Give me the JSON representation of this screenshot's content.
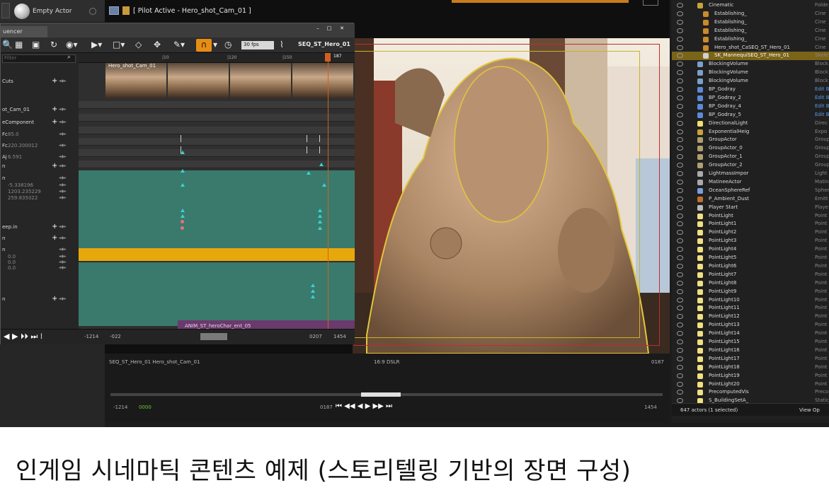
{
  "left_panel": {
    "actor_label": "Empty Actor"
  },
  "viewport": {
    "title": "[ Pilot Active - Hero_shot_Cam_01 ]",
    "info_left": "SEQ_ST_Hero_01  Hero_shot_Cam_01",
    "info_center": "16:9 DSLR",
    "info_right": "0187",
    "ctrl_start": "-1214",
    "ctrl_start2": "0000",
    "ctrl_mid": "0187",
    "ctrl_end_red": "",
    "ctrl_end": "1454"
  },
  "sequencer": {
    "tab_label": "uencer",
    "fps": "30 fps",
    "sequence_name": "SEQ_ST_Hero_01",
    "search_placeholder": "Filter",
    "ruler_end": "187",
    "ruler_labels": [
      "|10",
      "|120",
      "|150",
      "|1"
    ],
    "shot_label": "Hero_shot_Cam_01",
    "anim_clip": "ANIM_ST_heroChar_ent_05",
    "tracks": [
      {
        "label": "Cuts"
      },
      {
        "label": "ot_Cam_01"
      },
      {
        "label": "eComponent"
      },
      {
        "label": "Fc",
        "value": "85.0"
      },
      {
        "label": "Fc",
        "value": "220.200012"
      },
      {
        "label": "Aj",
        "value": "6.591"
      },
      {
        "label": "n"
      },
      {
        "label": "n"
      },
      {
        "label": "",
        "value": "-5.338196"
      },
      {
        "label": "",
        "value": "1203.235229"
      },
      {
        "label": "",
        "value": "259.835022"
      },
      {
        "label": "eep.in"
      },
      {
        "label": "n"
      },
      {
        "label": "n"
      },
      {
        "label": "",
        "value": "0.0"
      },
      {
        "label": "",
        "value": "0.0"
      },
      {
        "label": "",
        "value": "0.0"
      },
      {
        "label": "n"
      }
    ],
    "bottom_left": "-1214",
    "bottom_left2": "-022",
    "bottom_right": "0207",
    "bottom_right2": "1454"
  },
  "outliner": {
    "rows": [
      {
        "name": "Cinematic",
        "type": "Folde"
      },
      {
        "name": "Establishing_",
        "type": "Cine"
      },
      {
        "name": "Establishing_",
        "type": "Cine"
      },
      {
        "name": "Establishing_",
        "type": "Cine"
      },
      {
        "name": "Establishing_",
        "type": "Cine"
      },
      {
        "name": "Hero_shot_CaSEQ_ST_Hero_01",
        "type": "Cine"
      },
      {
        "name": "SK_MannequiSEQ_ST_Hero_01",
        "type": "Skele"
      },
      {
        "name": "BlockingVolume",
        "type": "Block"
      },
      {
        "name": "BlockingVolume",
        "type": "Block"
      },
      {
        "name": "BlockingVolume",
        "type": "Block"
      },
      {
        "name": "BP_Godray",
        "type": "Edit B"
      },
      {
        "name": "BP_Godray_2",
        "type": "Edit B"
      },
      {
        "name": "BP_Godray_4",
        "type": "Edit B"
      },
      {
        "name": "BP_Godray_5",
        "type": "Edit B"
      },
      {
        "name": "DirectionalLight",
        "type": "Direc"
      },
      {
        "name": "ExponentialHeig",
        "type": "Expo"
      },
      {
        "name": "GroupActor",
        "type": "Group"
      },
      {
        "name": "GroupActor_0",
        "type": "Group"
      },
      {
        "name": "GroupActor_1",
        "type": "Group"
      },
      {
        "name": "GroupActor_2",
        "type": "Group"
      },
      {
        "name": "LightmassImpor",
        "type": "Light"
      },
      {
        "name": "MatineeActor",
        "type": "Matin"
      },
      {
        "name": "OceanSphereRef",
        "type": "Spher"
      },
      {
        "name": "P_Ambient_Dust",
        "type": "Emitt"
      },
      {
        "name": "Player Start",
        "type": "Playe"
      },
      {
        "name": "PointLight",
        "type": "Point"
      },
      {
        "name": "PointLight1",
        "type": "Point"
      },
      {
        "name": "PointLight2",
        "type": "Point"
      },
      {
        "name": "PointLight3",
        "type": "Point"
      },
      {
        "name": "PointLight4",
        "type": "Point"
      },
      {
        "name": "PointLight5",
        "type": "Point"
      },
      {
        "name": "PointLight6",
        "type": "Point"
      },
      {
        "name": "PointLight7",
        "type": "Point"
      },
      {
        "name": "PointLight8",
        "type": "Point"
      },
      {
        "name": "PointLight9",
        "type": "Point"
      },
      {
        "name": "PointLight10",
        "type": "Point"
      },
      {
        "name": "PointLight11",
        "type": "Point"
      },
      {
        "name": "PointLight12",
        "type": "Point"
      },
      {
        "name": "PointLight13",
        "type": "Point"
      },
      {
        "name": "PointLight14",
        "type": "Point"
      },
      {
        "name": "PointLight15",
        "type": "Point"
      },
      {
        "name": "PointLight16",
        "type": "Point"
      },
      {
        "name": "PointLight17",
        "type": "Point"
      },
      {
        "name": "PointLight18",
        "type": "Point"
      },
      {
        "name": "PointLight19",
        "type": "Point"
      },
      {
        "name": "PointLight20",
        "type": "Point"
      },
      {
        "name": "PrecomputedVis",
        "type": "Preco"
      },
      {
        "name": "S_BuildingSetA_",
        "type": "Static"
      }
    ],
    "selected_index": 6,
    "footer_count": "647 actors (1 selected)",
    "footer_view": "View Op"
  },
  "caption": "인게임 시네마틱 콘텐츠 예제 (스토리텔링 기반의 장면 구성)"
}
